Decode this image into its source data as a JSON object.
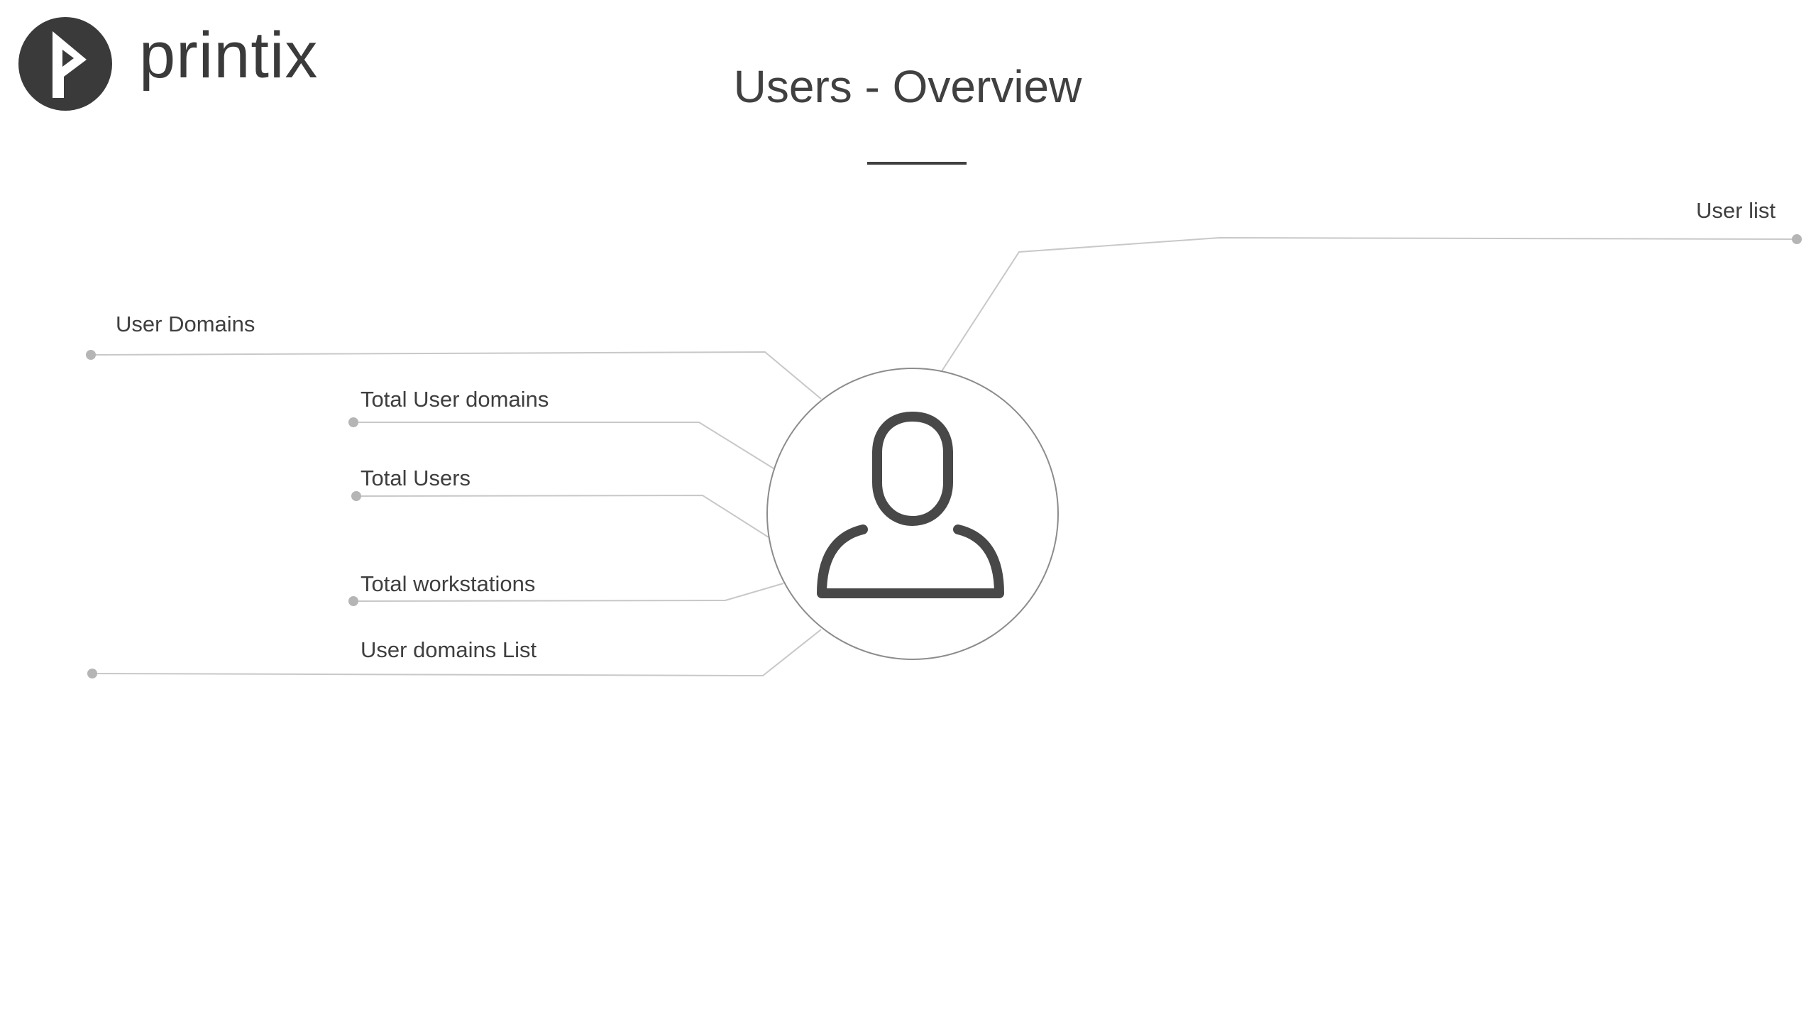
{
  "brand": {
    "name": "printix"
  },
  "page": {
    "title": "Users - Overview"
  },
  "hub": {
    "icon": "user-icon"
  },
  "links": {
    "user_list": "User list",
    "user_domains": "User Domains",
    "total_user_domains": "Total User domains",
    "total_users": "Total Users",
    "total_workstations": "Total workstations",
    "user_domains_list": "User domains List"
  },
  "colors": {
    "text": "#404040",
    "connector": "#c8c8c8",
    "dot": "#b5b5b5",
    "icon": "#484848"
  }
}
